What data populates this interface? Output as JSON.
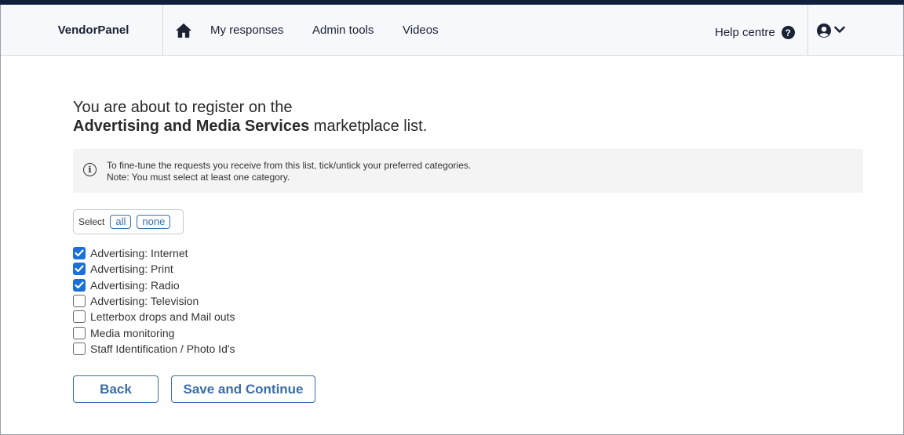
{
  "nav": {
    "brand": "VendorPanel",
    "links": [
      "My responses",
      "Admin tools",
      "Videos"
    ],
    "help": "Help centre",
    "icons": {
      "home": "home-icon",
      "help": "question-circle-icon",
      "user": "user-circle-icon",
      "chevron": "chevron-down-icon"
    }
  },
  "page": {
    "heading_line1": "You are about to register on the",
    "heading_bold": "Advertising and Media Services",
    "heading_rest": " marketplace list."
  },
  "info": {
    "line1": "To fine-tune the requests you receive from this list, tick/untick your preferred categories.",
    "line2": "Note: You must select at least one category."
  },
  "select": {
    "label": "Select",
    "all": "all",
    "none": "none"
  },
  "categories": [
    {
      "label": "Advertising: Internet",
      "checked": true
    },
    {
      "label": "Advertising: Print",
      "checked": true
    },
    {
      "label": "Advertising: Radio",
      "checked": true
    },
    {
      "label": "Advertising: Television",
      "checked": false
    },
    {
      "label": "Letterbox drops and Mail outs",
      "checked": false
    },
    {
      "label": "Media monitoring",
      "checked": false
    },
    {
      "label": "Staff Identification / Photo Id's",
      "checked": false
    }
  ],
  "buttons": {
    "back": "Back",
    "save": "Save and Continue"
  },
  "colors": {
    "accent": "#3a6ea5",
    "checkbox": "#1a6fd8",
    "topbar": "#0f1f3d"
  }
}
